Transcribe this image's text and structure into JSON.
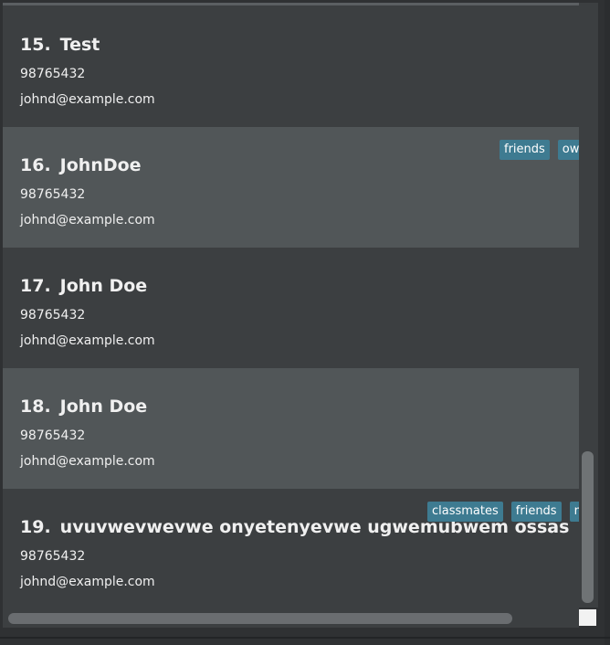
{
  "persons": [
    {
      "index": "15.",
      "name": "Test",
      "phone": "98765432",
      "email": "johnd@example.com",
      "tags": []
    },
    {
      "index": "16.",
      "name": "JohnDoe",
      "phone": "98765432",
      "email": "johnd@example.com",
      "tags": [
        "friends",
        "owe"
      ]
    },
    {
      "index": "17.",
      "name": "John Doe",
      "phone": "98765432",
      "email": "johnd@example.com",
      "tags": []
    },
    {
      "index": "18.",
      "name": "John Doe",
      "phone": "98765432",
      "email": "johnd@example.com",
      "tags": []
    },
    {
      "index": "19.",
      "name": "uvuvwevwevwe onyetenyevwe ugwemubwem ossas",
      "phone": "98765432",
      "email": "johnd@example.com",
      "tags": [
        "classmates",
        "friends",
        "nei"
      ]
    }
  ],
  "colors": {
    "card_even": "#3c3f41",
    "card_odd": "#515658",
    "tag_bg": "#3e7b91"
  }
}
